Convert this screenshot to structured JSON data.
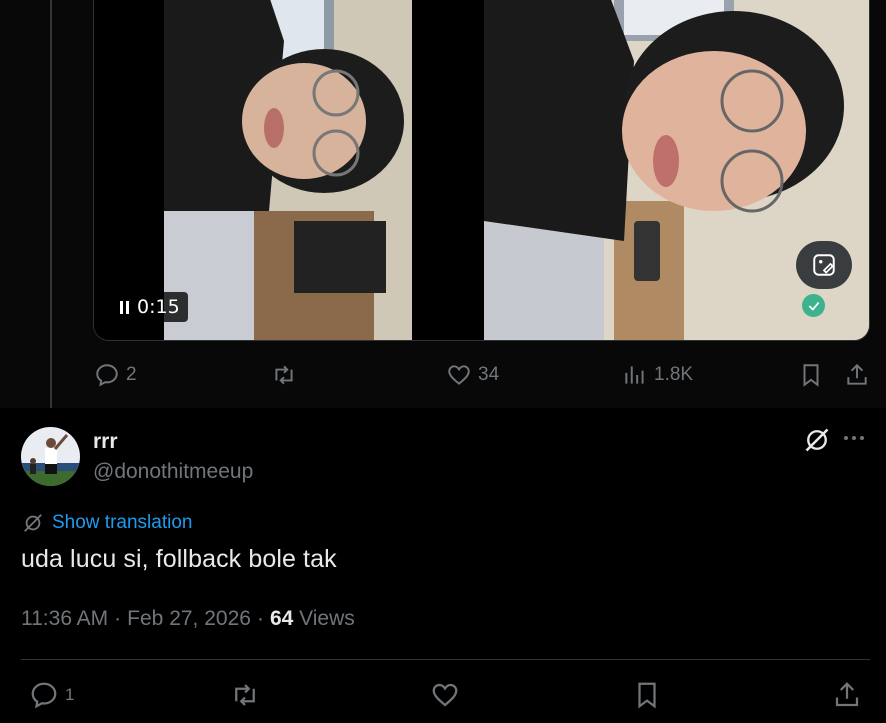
{
  "parent_tweet": {
    "video": {
      "time": "0:15"
    },
    "actions": {
      "replies": "2",
      "reposts": "",
      "likes": "34",
      "views": "1.8K"
    }
  },
  "reply_tweet": {
    "display_name": "rrr",
    "handle": "@donothitmeeup",
    "translation_link": "Show translation",
    "text": "uda lucu si, follback bole tak",
    "time": "11:36 AM",
    "separator": "·",
    "date": "Feb 27, 2026",
    "views_count": "64",
    "views_label": "Views",
    "actions": {
      "replies": "1"
    }
  },
  "colors": {
    "background": "#000000",
    "text_primary": "#e7e9ea",
    "text_secondary": "#71767b",
    "link": "#1d9bf0",
    "border": "#2f3336"
  },
  "icons": [
    "reply-icon",
    "repost-icon",
    "like-icon",
    "views-icon",
    "bookmark-icon",
    "share-icon",
    "grok-icon",
    "more-icon",
    "translate-icon",
    "pause-icon",
    "edit-image-icon",
    "check-icon"
  ]
}
